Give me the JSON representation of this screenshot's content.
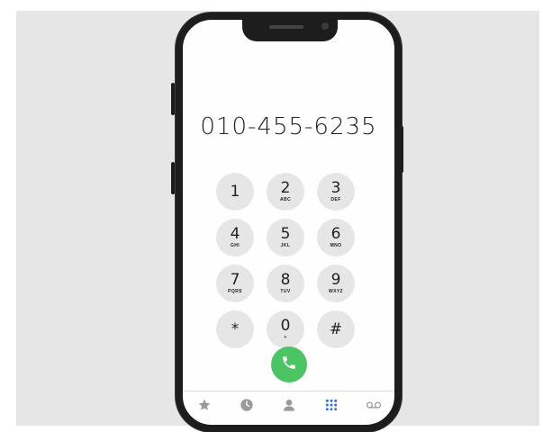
{
  "dialer": {
    "number": "010-455-6235",
    "keys": [
      {
        "digit": "1",
        "letters": ""
      },
      {
        "digit": "2",
        "letters": "ABC"
      },
      {
        "digit": "3",
        "letters": "DEF"
      },
      {
        "digit": "4",
        "letters": "GHI"
      },
      {
        "digit": "5",
        "letters": "JKL"
      },
      {
        "digit": "6",
        "letters": "MNO"
      },
      {
        "digit": "7",
        "letters": "PQRS"
      },
      {
        "digit": "8",
        "letters": "TUV"
      },
      {
        "digit": "9",
        "letters": "WXYZ"
      },
      {
        "digit": "*",
        "letters": ""
      },
      {
        "digit": "0",
        "letters": "+"
      },
      {
        "digit": "#",
        "letters": ""
      }
    ]
  },
  "tabs": [
    {
      "icon": "star-icon",
      "active": false
    },
    {
      "icon": "clock-icon",
      "active": false
    },
    {
      "icon": "contact-icon",
      "active": false
    },
    {
      "icon": "keypad-icon",
      "active": true
    },
    {
      "icon": "voicemail-icon",
      "active": false
    }
  ],
  "colors": {
    "call_button": "#4cc464",
    "active_tab": "#2f6fd6",
    "inactive_tab": "#9a9a9a",
    "key_background": "#e6e6e6",
    "backdrop": "#e6e6e6"
  }
}
